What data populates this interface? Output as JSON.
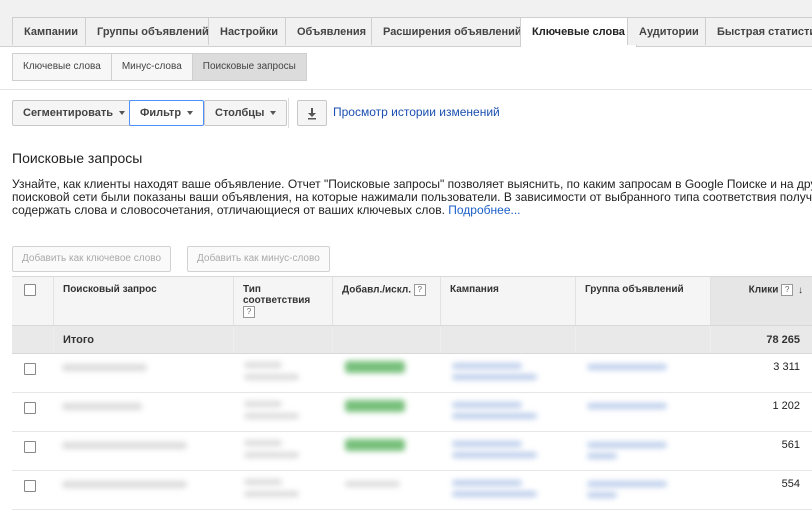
{
  "tabs": [
    {
      "label": "Кампании",
      "active": false
    },
    {
      "label": "Группы объявлений",
      "active": false
    },
    {
      "label": "Настройки",
      "active": false
    },
    {
      "label": "Объявления",
      "active": false
    },
    {
      "label": "Расширения объявлений",
      "active": false
    },
    {
      "label": "Ключевые слова",
      "active": true
    },
    {
      "label": "Аудитории",
      "active": false
    },
    {
      "label": "Быстрая статистика",
      "active": false
    }
  ],
  "subtabs": [
    {
      "label": "Ключевые слова",
      "active": false
    },
    {
      "label": "Минус-слова",
      "active": false
    },
    {
      "label": "Поисковые запросы",
      "active": true
    }
  ],
  "toolbar": {
    "segment_label": "Сегментировать",
    "filter_label": "Фильтр",
    "columns_label": "Столбцы",
    "download_icon": "download-icon",
    "history_link": "Просмотр истории изменений"
  },
  "page": {
    "title": "Поисковые запросы",
    "description_lines": [
      "Узнайте, как клиенты находят ваше объявление. Отчет \"Поисковые запросы\" позволяет выяснить, по каким запросам в Google Поиске и на других",
      "поисковой сети были показаны ваши объявления, на которые нажимали пользователи. В зависимости от выбранного типа соответствия полученн",
      "содержать слова и словосочетания, отличающиеся от ваших ключевых слов."
    ],
    "more_link": "Подробнее..."
  },
  "actions": {
    "add_keyword": "Добавить как ключевое слово",
    "add_negative": "Добавить как минус-слово"
  },
  "table": {
    "headers": {
      "query": "Поисковый запрос",
      "match_type": "Тип соответствия",
      "added_excluded": "Добавл./искл.",
      "campaign": "Кампания",
      "ad_group": "Группа объявлений",
      "clicks": "Клики"
    },
    "help_glyph": "?",
    "sort_glyph": "↓",
    "total_label": "Итого",
    "total_clicks": "78 265",
    "rows": [
      {
        "clicks": "3 311"
      },
      {
        "clicks": "1 202"
      },
      {
        "clicks": "561"
      },
      {
        "clicks": "554"
      }
    ]
  },
  "colors": {
    "active_tab_bg": "#ffffff",
    "link": "#1a4fb0",
    "filter_border": "#4d90fe",
    "blur_green": "#55b05a"
  }
}
